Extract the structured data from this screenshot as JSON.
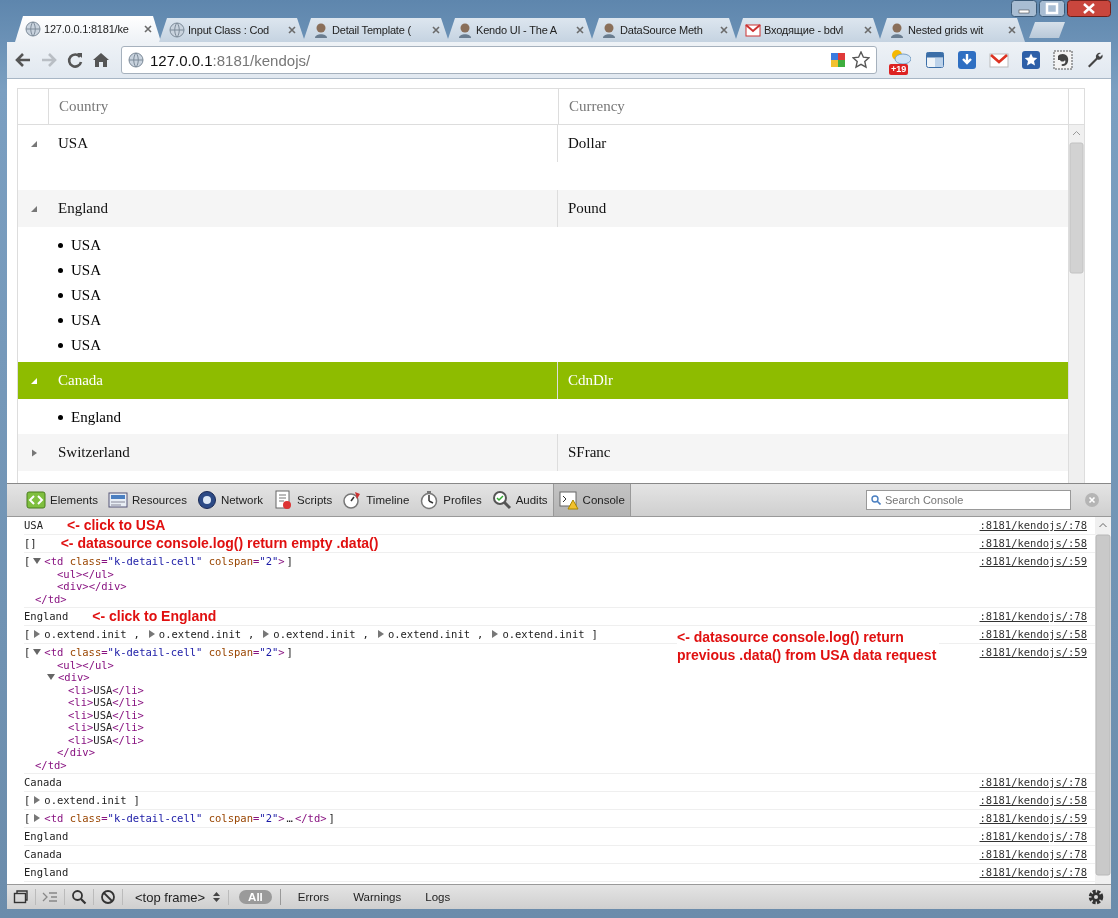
{
  "tabs": [
    {
      "title": "127.0.0.1:8181/ke",
      "kind": "globe",
      "selected": true
    },
    {
      "title": "Input Class : Cod",
      "kind": "globe",
      "selected": false
    },
    {
      "title": "Detail Template (",
      "kind": "avatar",
      "selected": false
    },
    {
      "title": "Kendo UI - The A",
      "kind": "avatar",
      "selected": false
    },
    {
      "title": "DataSource Meth",
      "kind": "avatar",
      "selected": false
    },
    {
      "title": "Входящие - bdvl",
      "kind": "mail",
      "selected": false
    },
    {
      "title": "Nested grids wit",
      "kind": "avatar",
      "selected": false
    }
  ],
  "address_bar": {
    "host": "127.0.0.1",
    "path": ":8181/kendojs/"
  },
  "extension_badge": "+19",
  "grid": {
    "columns": [
      "Country",
      "Currency"
    ],
    "rows": [
      {
        "country": "USA",
        "currency": "Dollar",
        "expanded": true,
        "selected": false
      },
      {
        "country": "England",
        "currency": "Pound",
        "expanded": true,
        "selected": false,
        "details": [
          "USA",
          "USA",
          "USA",
          "USA",
          "USA"
        ]
      },
      {
        "country": "Canada",
        "currency": "CdnDlr",
        "expanded": true,
        "selected": true,
        "details": [
          "England"
        ]
      },
      {
        "country": "Switzerland",
        "currency": "SFranc",
        "expanded": false,
        "selected": false
      }
    ]
  },
  "devtools": {
    "panels": [
      {
        "label": "Elements",
        "kind": "elements",
        "selected": false
      },
      {
        "label": "Resources",
        "kind": "resources",
        "selected": false
      },
      {
        "label": "Network",
        "kind": "network",
        "selected": false
      },
      {
        "label": "Scripts",
        "kind": "scripts",
        "selected": false
      },
      {
        "label": "Timeline",
        "kind": "timeline",
        "selected": false
      },
      {
        "label": "Profiles",
        "kind": "profiles",
        "selected": false
      },
      {
        "label": "Audits",
        "kind": "audits",
        "selected": false
      },
      {
        "label": "Console",
        "kind": "console",
        "selected": true
      }
    ],
    "search": {
      "placeholder": "Search Console"
    },
    "messages": [
      {
        "kind": "text",
        "text": "USA",
        "note": "<- click to USA",
        "source": ":8181/kendojs/:78"
      },
      {
        "kind": "text",
        "text": "[]",
        "note": "<- datasource console.log() return empty .data()",
        "source": ":8181/kendojs/:58"
      },
      {
        "kind": "elements",
        "open": "[",
        "close": "]",
        "source": ":8181/kendojs/:59",
        "nodes": [
          {
            "tag": "<td class=\"k-detail-cell\" colspan=\"2\">",
            "expanded": true,
            "end": "</td>",
            "children": [
              {
                "tag": "<ul></ul>"
              },
              {
                "tag": "<div></div>"
              }
            ]
          }
        ]
      },
      {
        "kind": "text",
        "text": "England",
        "note": "<- click to England",
        "source": ":8181/kendojs/:78"
      },
      {
        "kind": "objects",
        "open": "[",
        "close": "]",
        "note": "<- datasource console.log() return previous .data() from USA data request",
        "source": ":8181/kendojs/:58",
        "items": [
          {
            "text": "o.extend.init",
            "after": ",",
            "expanded": false
          },
          {
            "text": "o.extend.init",
            "after": ",",
            "expanded": false
          },
          {
            "text": "o.extend.init",
            "after": ",",
            "expanded": false
          },
          {
            "text": "o.extend.init",
            "after": ",",
            "expanded": false
          },
          {
            "text": "o.extend.init",
            "expanded": false
          }
        ]
      },
      {
        "kind": "elements",
        "open": "[",
        "close": "]",
        "source": ":8181/kendojs/:59",
        "nodes": [
          {
            "tag": "<td class=\"k-detail-cell\" colspan=\"2\">",
            "expanded": true,
            "end": "</td>",
            "children": [
              {
                "tag": "<ul></ul>"
              },
              {
                "tag": "<div>",
                "expanded": true,
                "end": "</div>",
                "children": [
                  {
                    "tag": "<li>USA</li>"
                  },
                  {
                    "tag": "<li>USA</li>"
                  },
                  {
                    "tag": "<li>USA</li>"
                  },
                  {
                    "tag": "<li>USA</li>"
                  },
                  {
                    "tag": "<li>USA</li>"
                  }
                ]
              }
            ]
          }
        ]
      },
      {
        "kind": "text",
        "text": "Canada",
        "source": ":8181/kendojs/:78"
      },
      {
        "kind": "objects",
        "open": "[",
        "close": "]",
        "source": ":8181/kendojs/:58",
        "items": [
          {
            "text": "o.extend.init",
            "expanded": false
          }
        ]
      },
      {
        "kind": "elements",
        "open": "[",
        "close": "]",
        "source": ":8181/kendojs/:59",
        "nodes": [
          {
            "tag": "<td class=\"k-detail-cell\" colspan=\"2\">",
            "expanded": false,
            "collapsed_text": "…",
            "end": "</td>"
          }
        ]
      },
      {
        "kind": "text",
        "text": "England",
        "source": ":8181/kendojs/:78"
      },
      {
        "kind": "text",
        "text": "Canada",
        "source": ":8181/kendojs/:78"
      },
      {
        "kind": "text",
        "text": "England",
        "source": ":8181/kendojs/:78"
      }
    ],
    "bottom_bar": {
      "frame": "<top frame>",
      "filters": [
        {
          "label": "All",
          "selected": true
        },
        {
          "label": "Errors",
          "selected": false
        },
        {
          "label": "Warnings",
          "selected": false
        },
        {
          "label": "Logs",
          "selected": false
        }
      ]
    }
  }
}
